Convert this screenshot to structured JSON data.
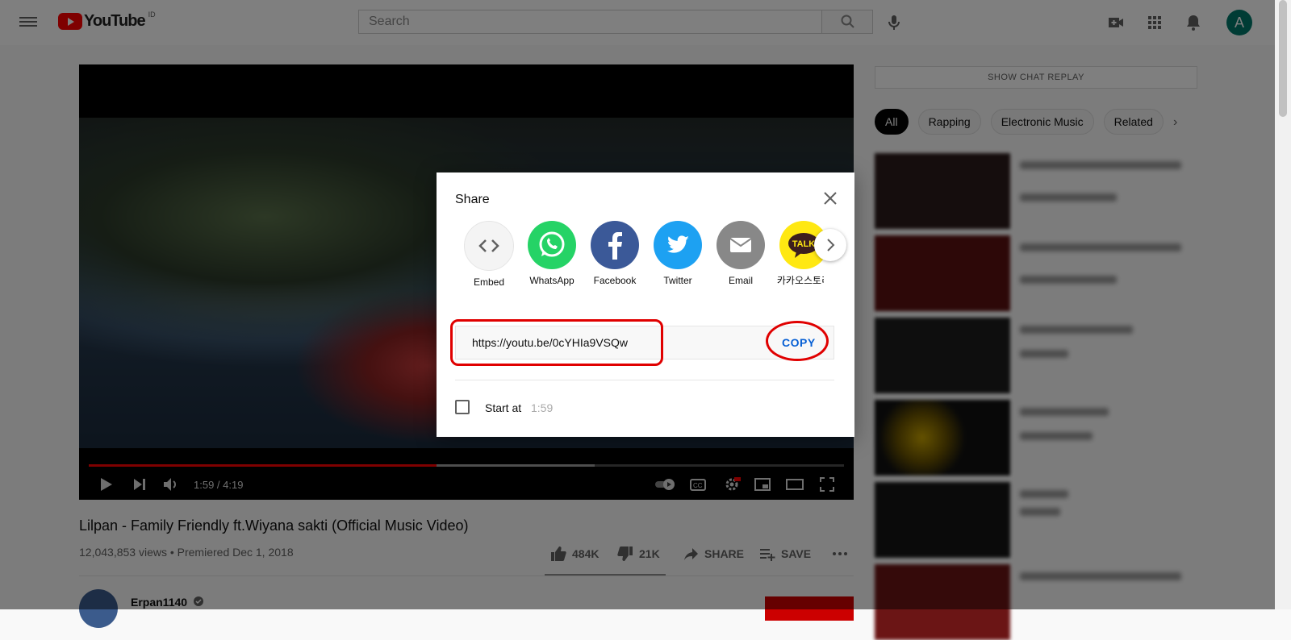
{
  "header": {
    "logo_text": "YouTube",
    "logo_country": "ID",
    "search_placeholder": "Search",
    "avatar_letter": "A",
    "accent_color": "#ff0000"
  },
  "player": {
    "time": "1:59 / 4:19",
    "played_fraction": 0.46,
    "loaded_fraction": 0.67
  },
  "video": {
    "title": "Lilpan - Family Friendly ft.Wiyana sakti (Official Music Video)",
    "meta": "12,043,853 views • Premiered Dec 1, 2018",
    "likes": "484K",
    "dislikes": "21K",
    "share_label": "SHARE",
    "save_label": "SAVE",
    "channel": "Erpan1140"
  },
  "sidebar": {
    "chat_replay": "SHOW CHAT REPLAY",
    "chips": [
      "All",
      "Rapping",
      "Electronic Music",
      "Related"
    ]
  },
  "share_dialog": {
    "title": "Share",
    "targets": [
      {
        "label": "Embed",
        "icon": "embed-icon",
        "color": "#f4f4f4"
      },
      {
        "label": "WhatsApp",
        "icon": "whatsapp-icon",
        "color": "#25d366"
      },
      {
        "label": "Facebook",
        "icon": "facebook-icon",
        "color": "#3b5998"
      },
      {
        "label": "Twitter",
        "icon": "twitter-icon",
        "color": "#1da1f2"
      },
      {
        "label": "Email",
        "icon": "email-icon",
        "color": "#888888"
      },
      {
        "label": "카카오스토리",
        "icon": "kakaotalk-icon",
        "color": "#ffe812"
      }
    ],
    "kakao_badge": "TALK",
    "url": "https://youtu.be/0cYHIa9VSQw",
    "copy_label": "COPY",
    "start_at_label": "Start at",
    "start_at_time": "1:59",
    "annotation_color": "#e00000"
  }
}
